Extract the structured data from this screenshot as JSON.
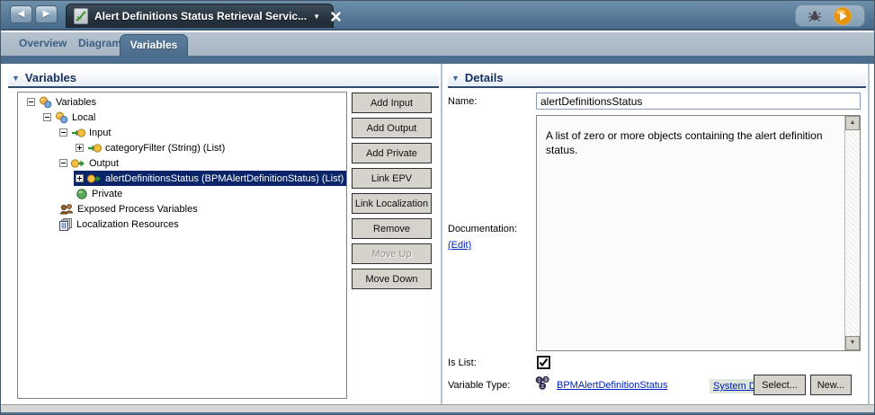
{
  "titlebar": {
    "doc_title": "Alert Definitions Status Retrieval Servic...",
    "back_icon": "◀",
    "forward_icon": "▶",
    "dropdown_icon": "▼"
  },
  "tabs": [
    {
      "label": "Overview",
      "active": false
    },
    {
      "label": "Diagram",
      "active": false
    },
    {
      "label": "Variables",
      "active": true
    }
  ],
  "variables_panel": {
    "title": "Variables",
    "collapse_icon": "▼",
    "tree": [
      {
        "label": "Variables",
        "level": 0,
        "expander": "minus",
        "icon": "variables-icon",
        "selected": false
      },
      {
        "label": "Local",
        "level": 1,
        "expander": "minus",
        "icon": "variables-icon",
        "selected": false
      },
      {
        "label": "Input",
        "level": 2,
        "expander": "minus",
        "icon": "input-icon",
        "selected": false
      },
      {
        "label": "categoryFilter (String) (List)",
        "level": 3,
        "expander": "plus",
        "icon": "input-icon",
        "selected": false
      },
      {
        "label": "Output",
        "level": 2,
        "expander": "minus",
        "icon": "output-icon",
        "selected": false
      },
      {
        "label": "alertDefinitionsStatus (BPMAlertDefinitionStatus) (List)",
        "level": 3,
        "expander": "plus",
        "icon": "output-icon",
        "selected": true
      },
      {
        "label": "Private",
        "level": 3,
        "expander": "none",
        "icon": "private-icon",
        "selected": false
      },
      {
        "label": "Exposed Process Variables",
        "level": 2,
        "expander": "none",
        "icon": "epv-icon",
        "selected": false
      },
      {
        "label": "Localization Resources",
        "level": 2,
        "expander": "none",
        "icon": "localization-icon",
        "selected": false
      }
    ],
    "buttons": [
      {
        "label": "Add Input",
        "enabled": true
      },
      {
        "label": "Add Output",
        "enabled": true
      },
      {
        "label": "Add Private",
        "enabled": true
      },
      {
        "label": "Link EPV",
        "enabled": true
      },
      {
        "label": "Link Localization",
        "enabled": true
      },
      {
        "label": "Remove",
        "enabled": true
      },
      {
        "label": "Move Up",
        "enabled": false
      },
      {
        "label": "Move Down",
        "enabled": true
      }
    ]
  },
  "details_panel": {
    "title": "Details",
    "collapse_icon": "▼",
    "name_label": "Name:",
    "name_value": "alertDefinitionsStatus",
    "documentation_label": "Documentation:",
    "edit_link": "(Edit)",
    "documentation_text": "A list of zero or more objects containing the alert definition status.",
    "is_list_label": "Is List:",
    "is_list_checked": true,
    "variable_type_label": "Variable Type:",
    "variable_type_value": "BPMAlertDefinitionStatus",
    "system_data_link": "System Data",
    "select_button": "Select...",
    "new_button": "New..."
  },
  "colors": {
    "accent_blue": "#4c6d8d",
    "selection_blue": "#0a246a",
    "link_blue": "#0023bb",
    "play_orange": "#e8920c"
  }
}
